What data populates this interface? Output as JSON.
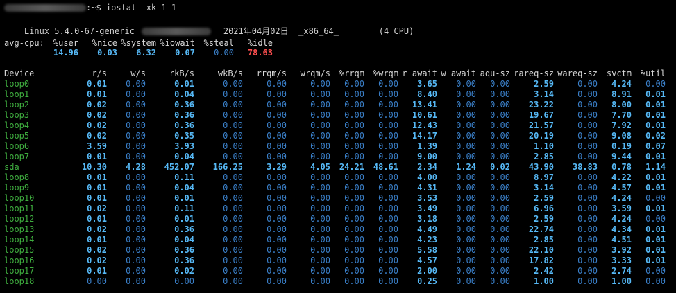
{
  "prompt": {
    "suffix": ":~$ iostat -xk 1 1"
  },
  "sysinfo": {
    "kernel": "Linux 5.4.0-67-generic",
    "date": "2021年04月02日",
    "arch": "_x86_64_",
    "cpus": "(4 CPU)"
  },
  "cpu": {
    "label": "avg-cpu:",
    "headers": [
      "%user",
      "%nice",
      "%system",
      "%iowait",
      "%steal",
      "%idle"
    ],
    "values": [
      "14.96",
      "0.03",
      "6.32",
      "0.07",
      "0.00",
      "78.63"
    ]
  },
  "device_table": {
    "headers": [
      "Device",
      "r/s",
      "w/s",
      "rkB/s",
      "wkB/s",
      "rrqm/s",
      "wrqm/s",
      "%rrqm",
      "%wrqm",
      "r_await",
      "w_await",
      "aqu-sz",
      "rareq-sz",
      "wareq-sz",
      "svctm",
      "%util"
    ],
    "rows": [
      [
        "loop0",
        "0.01",
        "0.00",
        "0.01",
        "0.00",
        "0.00",
        "0.00",
        "0.00",
        "0.00",
        "3.65",
        "0.00",
        "0.00",
        "2.59",
        "0.00",
        "4.24",
        "0.00"
      ],
      [
        "loop1",
        "0.01",
        "0.00",
        "0.04",
        "0.00",
        "0.00",
        "0.00",
        "0.00",
        "0.00",
        "8.40",
        "0.00",
        "0.00",
        "3.14",
        "0.00",
        "8.91",
        "0.01"
      ],
      [
        "loop2",
        "0.02",
        "0.00",
        "0.36",
        "0.00",
        "0.00",
        "0.00",
        "0.00",
        "0.00",
        "13.41",
        "0.00",
        "0.00",
        "23.22",
        "0.00",
        "8.00",
        "0.01"
      ],
      [
        "loop3",
        "0.02",
        "0.00",
        "0.36",
        "0.00",
        "0.00",
        "0.00",
        "0.00",
        "0.00",
        "10.61",
        "0.00",
        "0.00",
        "19.67",
        "0.00",
        "7.70",
        "0.01"
      ],
      [
        "loop4",
        "0.02",
        "0.00",
        "0.36",
        "0.00",
        "0.00",
        "0.00",
        "0.00",
        "0.00",
        "12.43",
        "0.00",
        "0.00",
        "21.57",
        "0.00",
        "7.92",
        "0.01"
      ],
      [
        "loop5",
        "0.02",
        "0.00",
        "0.35",
        "0.00",
        "0.00",
        "0.00",
        "0.00",
        "0.00",
        "14.17",
        "0.00",
        "0.00",
        "20.19",
        "0.00",
        "9.08",
        "0.02"
      ],
      [
        "loop6",
        "3.59",
        "0.00",
        "3.93",
        "0.00",
        "0.00",
        "0.00",
        "0.00",
        "0.00",
        "1.39",
        "0.00",
        "0.00",
        "1.10",
        "0.00",
        "0.19",
        "0.07"
      ],
      [
        "loop7",
        "0.01",
        "0.00",
        "0.04",
        "0.00",
        "0.00",
        "0.00",
        "0.00",
        "0.00",
        "9.00",
        "0.00",
        "0.00",
        "2.85",
        "0.00",
        "9.44",
        "0.01"
      ],
      [
        "sda",
        "10.30",
        "4.28",
        "452.07",
        "166.25",
        "3.29",
        "4.05",
        "24.21",
        "48.61",
        "2.34",
        "1.24",
        "0.02",
        "43.90",
        "38.83",
        "0.78",
        "1.14"
      ],
      [
        "loop8",
        "0.01",
        "0.00",
        "0.11",
        "0.00",
        "0.00",
        "0.00",
        "0.00",
        "0.00",
        "4.00",
        "0.00",
        "0.00",
        "8.97",
        "0.00",
        "4.22",
        "0.01"
      ],
      [
        "loop9",
        "0.01",
        "0.00",
        "0.04",
        "0.00",
        "0.00",
        "0.00",
        "0.00",
        "0.00",
        "4.31",
        "0.00",
        "0.00",
        "3.14",
        "0.00",
        "4.57",
        "0.01"
      ],
      [
        "loop10",
        "0.01",
        "0.00",
        "0.01",
        "0.00",
        "0.00",
        "0.00",
        "0.00",
        "0.00",
        "3.53",
        "0.00",
        "0.00",
        "2.59",
        "0.00",
        "4.24",
        "0.00"
      ],
      [
        "loop11",
        "0.02",
        "0.00",
        "0.11",
        "0.00",
        "0.00",
        "0.00",
        "0.00",
        "0.00",
        "3.49",
        "0.00",
        "0.00",
        "6.96",
        "0.00",
        "3.59",
        "0.01"
      ],
      [
        "loop12",
        "0.01",
        "0.00",
        "0.01",
        "0.00",
        "0.00",
        "0.00",
        "0.00",
        "0.00",
        "3.18",
        "0.00",
        "0.00",
        "2.59",
        "0.00",
        "4.24",
        "0.00"
      ],
      [
        "loop13",
        "0.02",
        "0.00",
        "0.36",
        "0.00",
        "0.00",
        "0.00",
        "0.00",
        "0.00",
        "4.49",
        "0.00",
        "0.00",
        "22.74",
        "0.00",
        "4.34",
        "0.01"
      ],
      [
        "loop14",
        "0.01",
        "0.00",
        "0.04",
        "0.00",
        "0.00",
        "0.00",
        "0.00",
        "0.00",
        "4.23",
        "0.00",
        "0.00",
        "2.85",
        "0.00",
        "4.51",
        "0.01"
      ],
      [
        "loop15",
        "0.02",
        "0.00",
        "0.36",
        "0.00",
        "0.00",
        "0.00",
        "0.00",
        "0.00",
        "5.58",
        "0.00",
        "0.00",
        "22.10",
        "0.00",
        "3.92",
        "0.01"
      ],
      [
        "loop16",
        "0.02",
        "0.00",
        "0.36",
        "0.00",
        "0.00",
        "0.00",
        "0.00",
        "0.00",
        "4.57",
        "0.00",
        "0.00",
        "17.82",
        "0.00",
        "3.33",
        "0.01"
      ],
      [
        "loop17",
        "0.01",
        "0.00",
        "0.02",
        "0.00",
        "0.00",
        "0.00",
        "0.00",
        "0.00",
        "2.00",
        "0.00",
        "0.00",
        "2.42",
        "0.00",
        "2.74",
        "0.00"
      ],
      [
        "loop18",
        "0.00",
        "0.00",
        "0.00",
        "0.00",
        "0.00",
        "0.00",
        "0.00",
        "0.00",
        "0.25",
        "0.00",
        "0.00",
        "1.00",
        "0.00",
        "1.00",
        "0.00"
      ]
    ]
  },
  "colors": {
    "background": "#000000",
    "text": "#cfcfcf",
    "device_green": "#3fae3f",
    "value_bright": "#56b8f5",
    "value_dim": "#3a7fc8",
    "idle_red": "#ff4f4f"
  }
}
